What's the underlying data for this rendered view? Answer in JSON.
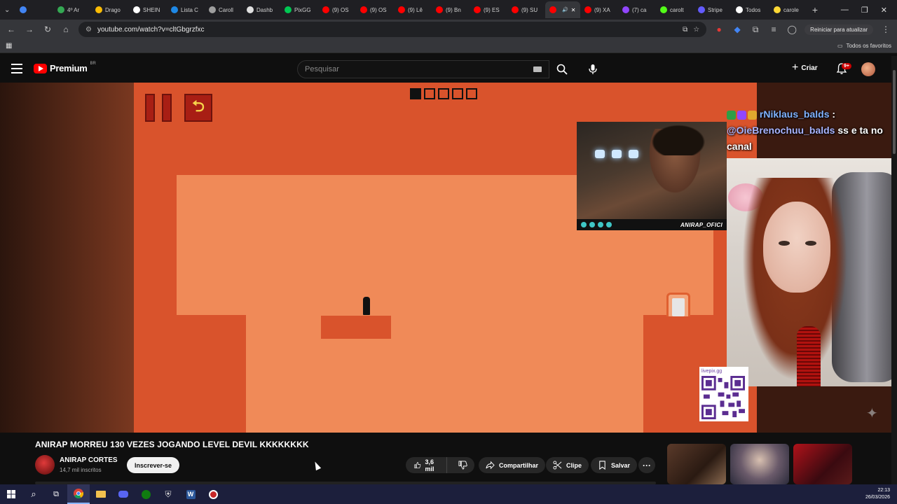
{
  "browser": {
    "tabs": [
      {
        "label": "",
        "color": "#4285f4"
      },
      {
        "label": "4º Ar",
        "color": "#34a853"
      },
      {
        "label": "Drago",
        "color": "#fbbc05"
      },
      {
        "label": "SHEIN",
        "color": "#ffffff"
      },
      {
        "label": "Lista C",
        "color": "#1e88e5"
      },
      {
        "label": "Caroll",
        "color": "#9e9e9e"
      },
      {
        "label": "Dashb",
        "color": "#e0e0e0"
      },
      {
        "label": "PixGG",
        "color": "#00c853"
      },
      {
        "label": "(9) OS",
        "color": "#ff0000"
      },
      {
        "label": "(9) OS",
        "color": "#ff0000"
      },
      {
        "label": "(9) Lê",
        "color": "#ff0000"
      },
      {
        "label": "(9) Bn",
        "color": "#ff0000"
      },
      {
        "label": "(9) ES",
        "color": "#ff0000"
      },
      {
        "label": "(9) SU",
        "color": "#ff0000"
      },
      {
        "label": "",
        "color": "#ff0000",
        "active": true
      },
      {
        "label": "(9) XA",
        "color": "#ff0000"
      },
      {
        "label": "(7) ca",
        "color": "#9146ff"
      },
      {
        "label": "carolt",
        "color": "#53fc18"
      },
      {
        "label": "Stripe",
        "color": "#635bff"
      },
      {
        "label": "Todos",
        "color": "#ffffff"
      },
      {
        "label": "carole",
        "color": "#fdd835"
      }
    ],
    "url": "youtube.com/watch?v=cltGbgrzfxc",
    "restart_label": "Reiniciar para atualizar",
    "all_bookmarks": "Todos os favoritos"
  },
  "youtube": {
    "logo_text": "Premium",
    "region": "BR",
    "search_placeholder": "Pesquisar",
    "create_label": "Criar",
    "notif_badge": "9+"
  },
  "game": {
    "levels_total": 5,
    "levels_done": 1,
    "restart_glyph": "⮌"
  },
  "overlay": {
    "chat_user1": "rNiklaus_balds",
    "chat_colon": ":",
    "chat_mention": "@OieBrenochuu_balds",
    "chat_text": " ss e ta no canal",
    "cam_tag": "ANIRAP_OFICI",
    "qr_label": "livepix.gg"
  },
  "video": {
    "title": "ANIRAP MORREU 130 VEZES JOGANDO LEVEL DEVIL KKKKKKKK",
    "channel": "ANIRAP CORTES",
    "subscribers": "14,7 mil inscritos",
    "subscribe_label": "Inscrever-se",
    "likes": "3,6 mil",
    "share_label": "Compartilhar",
    "clip_label": "Clipe",
    "save_label": "Salvar",
    "more_label": "···"
  },
  "taskbar": {
    "time": "22:13",
    "date": "26/03/2026"
  }
}
